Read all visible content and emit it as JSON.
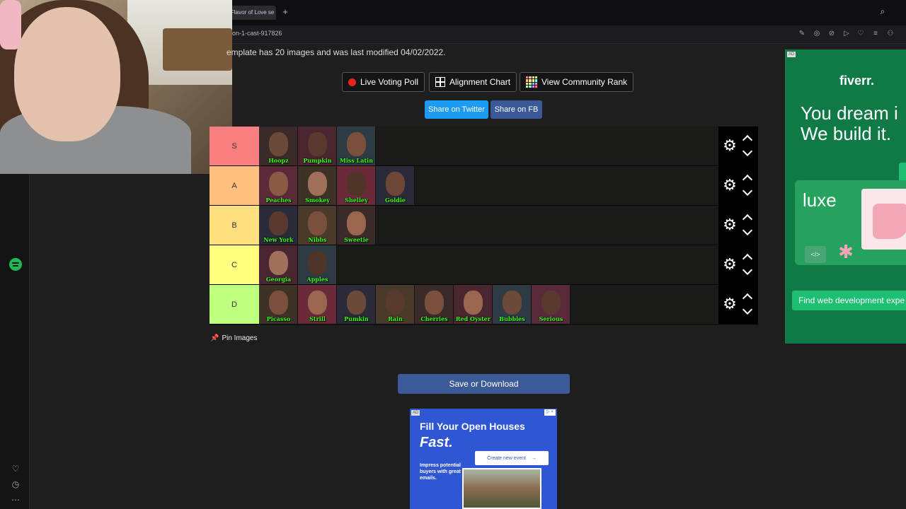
{
  "browser": {
    "tab_title": "Flavor of Love se",
    "new_tab_symbol": "+",
    "url": "on-1-cast-917826",
    "search_symbol": "⌕",
    "toolbar_icons": [
      "✎",
      "◎",
      "⊘",
      "▷",
      "♡",
      "≡",
      "⚇"
    ]
  },
  "sidebar": {
    "favorites_symbol": "♡",
    "history_symbol": "◷",
    "more_symbol": "⋯"
  },
  "page": {
    "template_info": "emplate has 20 images and was last modified 04/02/2022.",
    "buttons": {
      "live_voting": "Live Voting Poll",
      "alignment": "Alignment Chart",
      "community_rank": "View Community Rank",
      "share_twitter": "Share on Twitter",
      "share_fb": "Share on FB"
    },
    "pin_label": "Pin Images",
    "save_label": "Save or Download"
  },
  "tiers": [
    {
      "label": "S",
      "color": "#f77f7f",
      "items": [
        "Hoopz",
        "Pumpkin",
        "Miss Latin"
      ]
    },
    {
      "label": "A",
      "color": "#ffbf7f",
      "items": [
        "Peaches",
        "Smokey",
        "Shelley",
        "Goldie"
      ]
    },
    {
      "label": "B",
      "color": "#ffdf80",
      "items": [
        "New York",
        "Nibbs",
        "Sweetie"
      ]
    },
    {
      "label": "C",
      "color": "#ffff7f",
      "items": [
        "Georgia",
        "Apples"
      ]
    },
    {
      "label": "D",
      "color": "#bfff7f",
      "items": [
        "Picasso",
        "Strill",
        "Pumkin",
        "Rain",
        "Cherries",
        "Red Oyster",
        "Bubbles",
        "Serious"
      ]
    }
  ],
  "ad_bottom": {
    "tag": "AD",
    "close": "▷ ×",
    "headline": "Fill Your Open Houses",
    "headline2": "Fast.",
    "subtext": "Impress potential buyers with great emails.",
    "cta": "Create new event",
    "cta_arrow": "→"
  },
  "ad_right": {
    "tag": "AD",
    "logo": "fiverr.",
    "headline_line1": "You dream i",
    "headline_line2": "We build it.",
    "luxe": "luxe",
    "code_badge": "</>",
    "flower": "✱",
    "cta": "Find web development expe"
  },
  "colors": {
    "twitter": "#1d9bf0",
    "facebook": "#3b5998",
    "save": "#3d5a98",
    "fiverr_green": "#1dbf73",
    "spotify": "#1db954"
  }
}
